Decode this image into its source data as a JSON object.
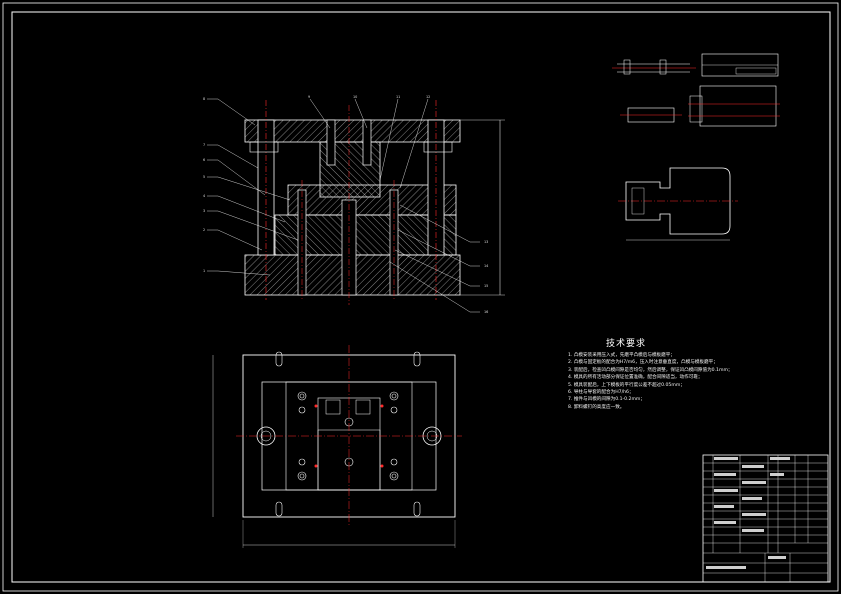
{
  "technical_requirements": {
    "title": "技术要求",
    "items": [
      "1. 凸模安装采用压入式，先磨平凸模后与模板磨平；",
      "2. 凸模与固定板的配合为H7/m6，压入时注意垂直度，凸模与模板磨平；",
      "3. 装配后，检查凹凸模间隙是否均匀，然后调整，保证凹凸模间隙值为0.1mm；",
      "4. 模具的所有活动部分保证位置准确，配合间隙适当，动作可靠；",
      "5. 模具装配后，上下模板的平行度公差不超过0.05mm；",
      "6. 导柱与导套的配合为H7/h6；",
      "7. 推件与凹模的间隙为0.1-0.2mm；",
      "8. 卸料螺钉的高度应一致。"
    ]
  },
  "callouts_left": [
    "8",
    "7",
    "6",
    "5",
    "4",
    "3",
    "2",
    "1"
  ],
  "callouts_top": [
    "9",
    "10",
    "11",
    "12"
  ],
  "callouts_right": [
    "13",
    "14",
    "15",
    "16"
  ],
  "title_block": {
    "rows": 9,
    "cols": 8
  },
  "colors": {
    "background": "#000000",
    "outline": "#ffffff",
    "section_fill": "#d8d8d8",
    "center_line": "#ff2a2a",
    "hatch": "#bdbdbd"
  }
}
